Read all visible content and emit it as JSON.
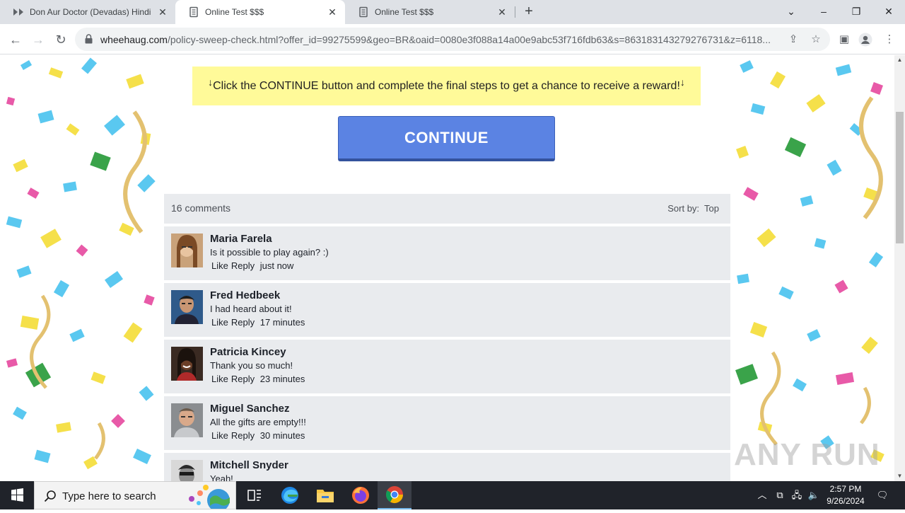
{
  "browser": {
    "tabs": [
      {
        "title": "Don Aur Doctor (Devadas) Hindi",
        "active": false
      },
      {
        "title": "Online Test $$$",
        "active": true
      },
      {
        "title": "Online Test $$$",
        "active": false
      }
    ],
    "url_host": "wheehaug.com",
    "url_path": "/policy-sweep-check.html?offer_id=99275599&geo=BR&oaid=0080e3f088a14a00e9abc53f716fdb63&s=863183143279276731&z=6118..."
  },
  "page": {
    "notice_arrow_left": "↓",
    "notice_text": "Click the CONTINUE button and complete the final steps to get a chance to receive a reward!",
    "notice_arrow_right": "↓",
    "continue_label": "CONTINUE",
    "comments_count": "16 comments",
    "sort_label": "Sort by:",
    "sort_value": "Top",
    "like_label": "Like",
    "reply_label": "Reply",
    "comments": [
      {
        "name": "Maria Farela",
        "text": "Is it possible to play again? :)",
        "time": "just now"
      },
      {
        "name": "Fred Hedbeek",
        "text": "I had heard about it!",
        "time": "17 minutes"
      },
      {
        "name": "Patricia Kincey",
        "text": "Thank you so much!",
        "time": "23 minutes"
      },
      {
        "name": "Miguel Sanchez",
        "text": "All the gifts are empty!!!",
        "time": "30 minutes"
      },
      {
        "name": "Mitchell Snyder",
        "text": "Yeah!",
        "time": ""
      }
    ],
    "watermark": "ANY RUN"
  },
  "taskbar": {
    "search_placeholder": "Type here to search",
    "time": "2:57 PM",
    "date": "9/26/2024"
  }
}
